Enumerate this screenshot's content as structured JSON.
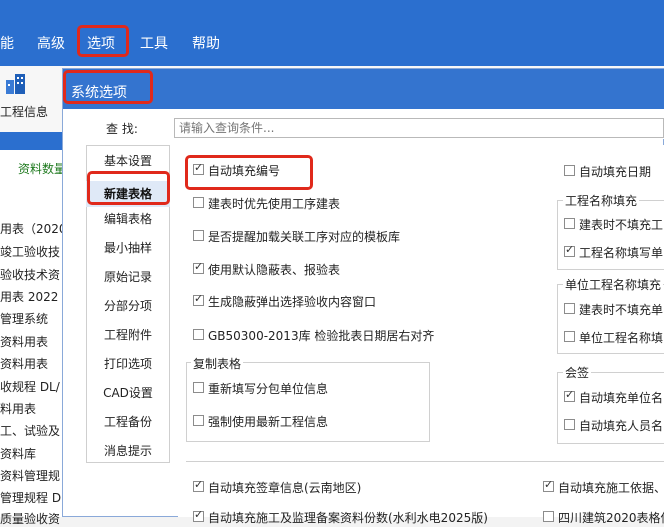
{
  "menu": {
    "items": [
      "能",
      "高级",
      "选项",
      "工具",
      "帮助"
    ]
  },
  "ribbon": {
    "label": "工程信息"
  },
  "left_panel": {
    "tab": "资料数量",
    "lines": [
      "用表（2020",
      "竣工验收技",
      "验收技术资",
      "用表 2022",
      "管理系统",
      "资料用表",
      "资料用表",
      "收规程 DL/",
      "料用表",
      "工、试验及",
      "资料库",
      "资料管理规",
      "管理规程 D",
      "质量验收资"
    ]
  },
  "dialog": {
    "title": "系统选项",
    "search_label": "查  找:",
    "search_placeholder": "请输入查询条件..."
  },
  "nav": {
    "items": [
      "基本设置",
      "新建表格",
      "编辑表格",
      "最小抽样",
      "原始记录",
      "分部分项",
      "工程附件",
      "打印选项",
      "CAD设置",
      "工程备份",
      "消息提示"
    ],
    "selected": "新建表格"
  },
  "options": {
    "auto_number": "自动填充编号",
    "prefer_process": "建表时优先使用工序建表",
    "prompt_template": "是否提醒加载关联工序对应的模板库",
    "default_hidden": "使用默认隐蔽表、报验表",
    "popup_hidden": "生成隐蔽弹出选择验收内容窗口",
    "gb_align": "GB50300-2013库 检验批表日期居右对齐",
    "copy_group": "复制表格",
    "refill_sub": "重新填写分包单位信息",
    "force_latest": "强制使用最新工程信息",
    "auto_date": "自动填充日期",
    "name_group": "工程名称填充",
    "no_fill_name": "建表时不填充工",
    "name_fill_unit": "工程名称填写单",
    "unit_name_group": "单位工程名称填充",
    "no_fill_unit": "建表时不填充单",
    "unit_fill_auto": "单位工程名称填",
    "sign_group": "会签",
    "auto_unit": "自动填充单位名",
    "auto_person": "自动填充人员名",
    "auto_sign": "自动填充签章信息(云南地区)",
    "auto_basis": "自动填充施工依据、",
    "bottom_left": "自动填充施工及监理备案资料份数(水利水电2025版)",
    "bottom_right": "四川建筑2020表格使"
  }
}
